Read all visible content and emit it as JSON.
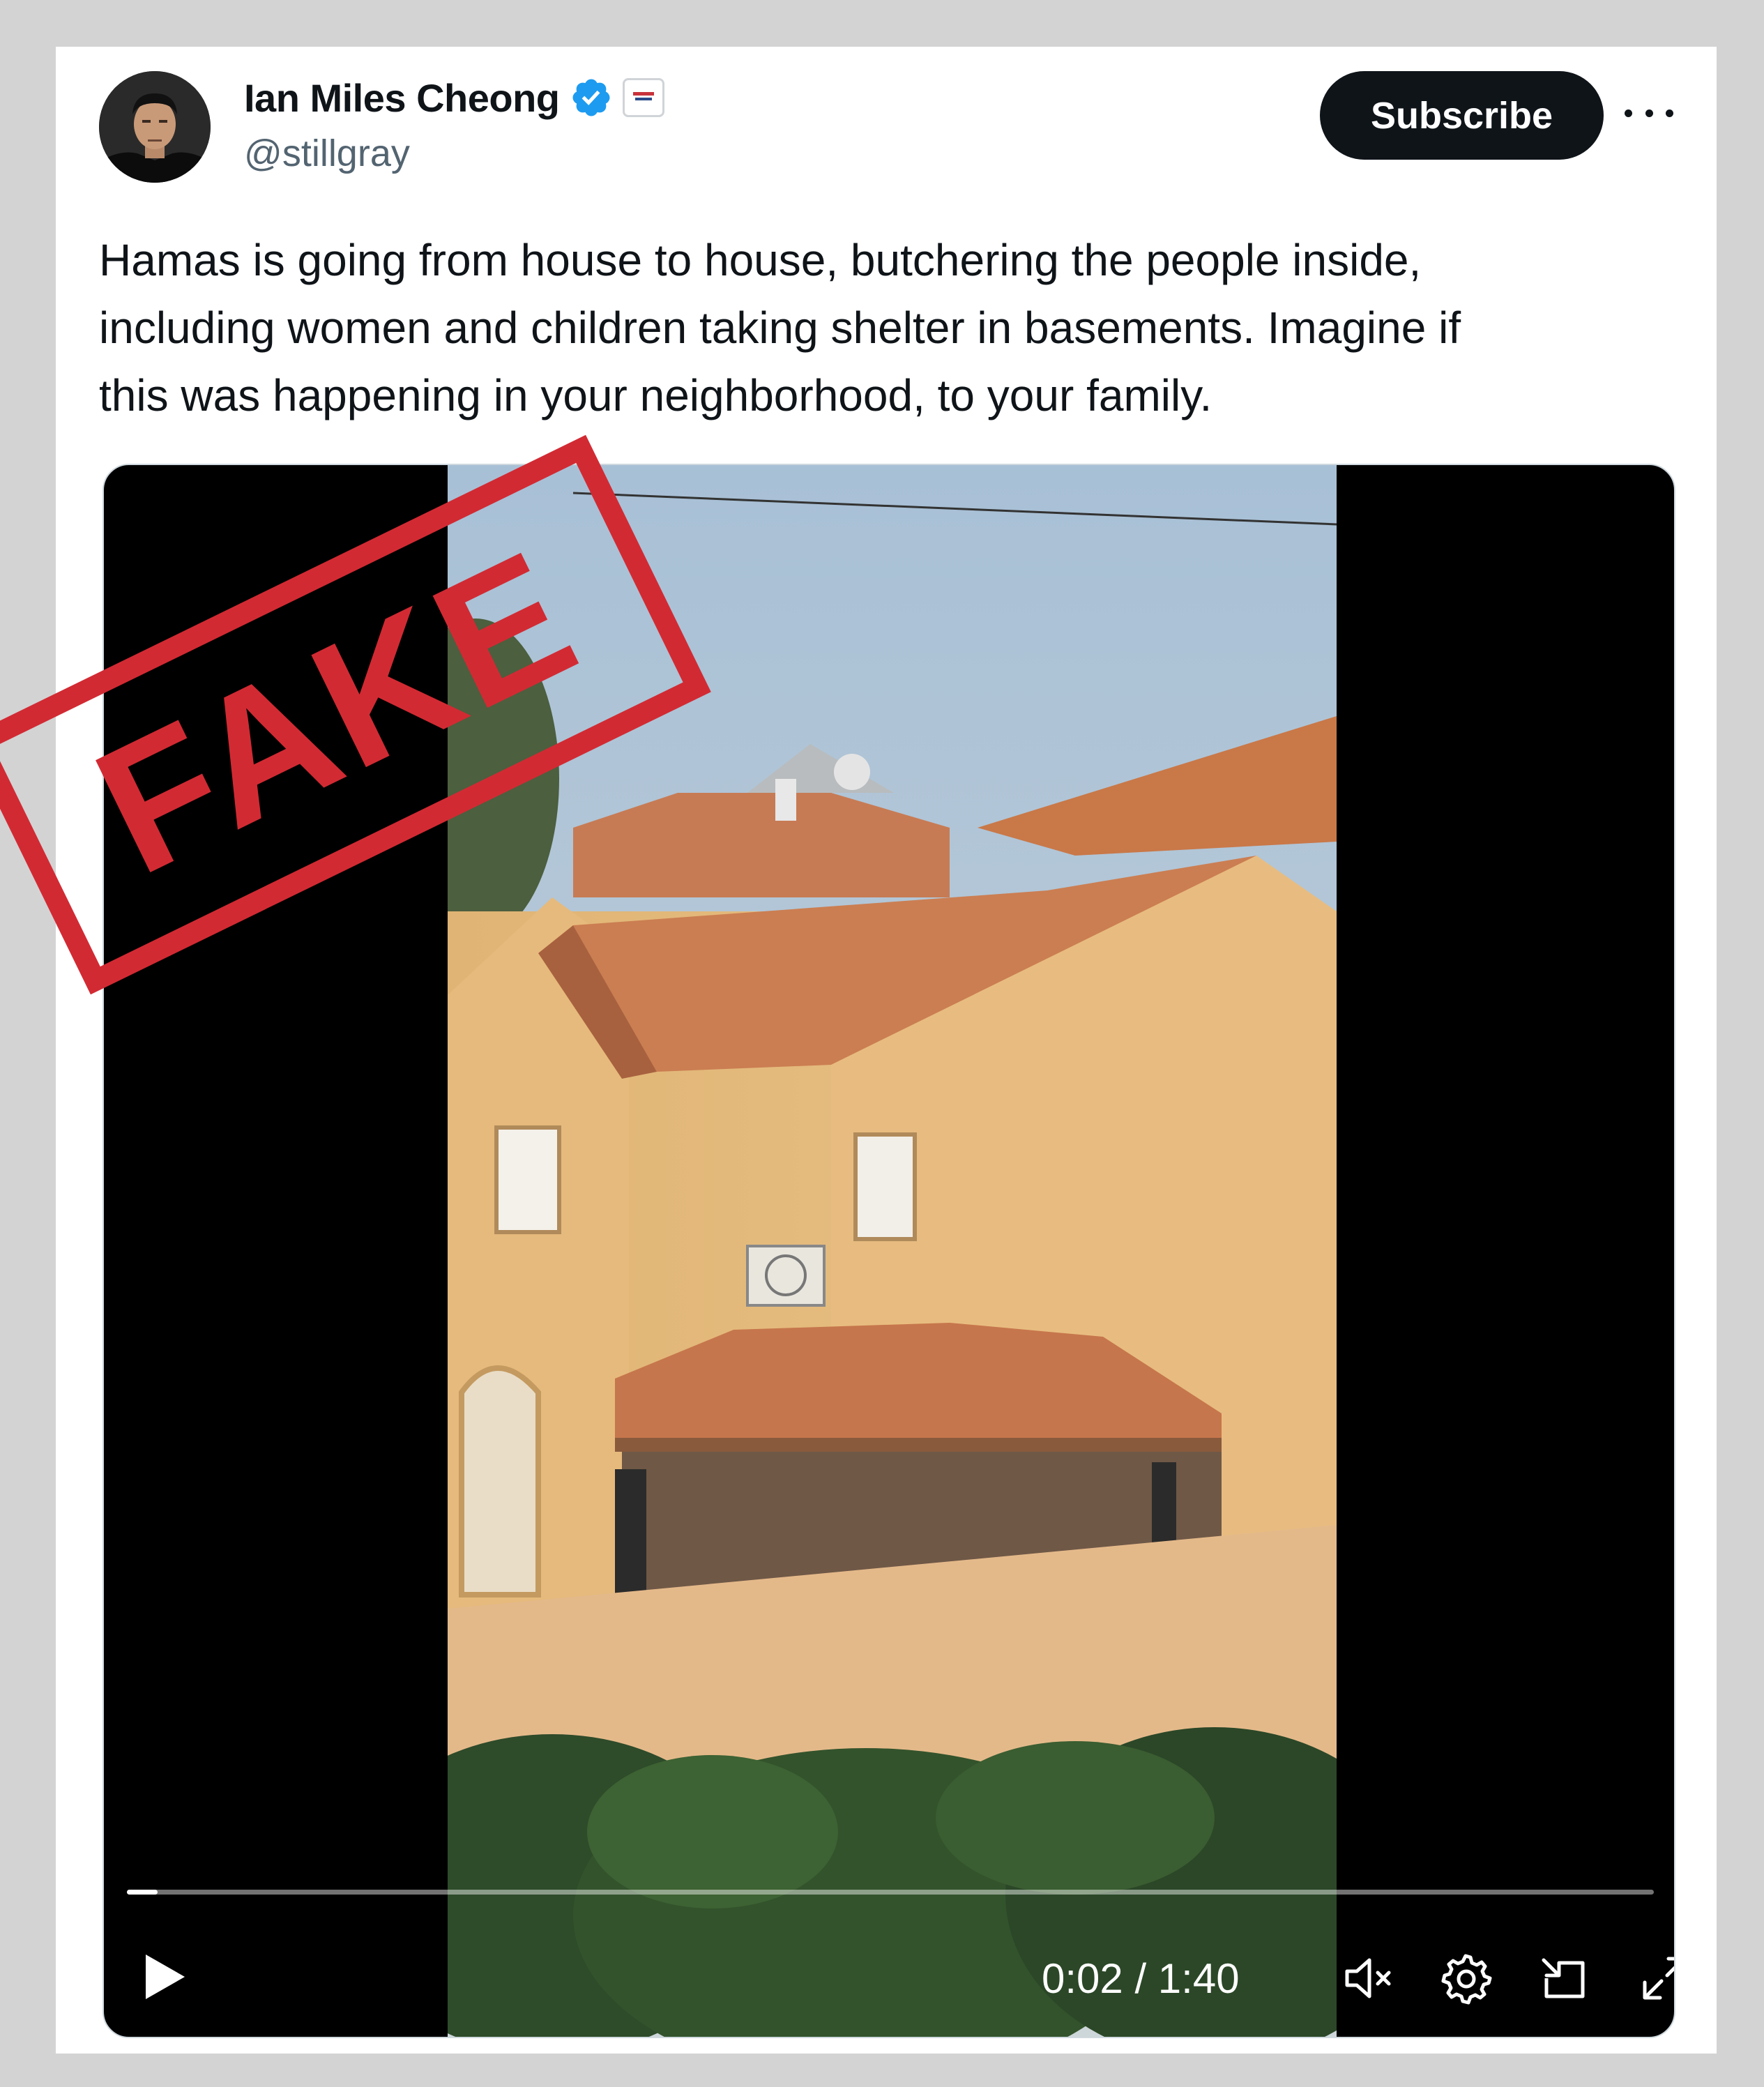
{
  "tweet": {
    "author_name": "Ian Miles Cheong",
    "handle": "@stillgray",
    "subscribe_label": "Subscribe",
    "text_lines": [
      "Hamas is going from house to house, butchering the people inside,",
      "including women and children taking shelter in basements. Imagine if",
      "this was happening in your neighborhood, to your family."
    ]
  },
  "video": {
    "current_time": "0:02",
    "duration": "1:40",
    "time_display": "0:02 / 1:40",
    "progress_fraction": 0.02
  },
  "overlay": {
    "stamp_text": "FAKE",
    "stamp_color": "#d22a33"
  },
  "colors": {
    "verified": "#1d9bf0",
    "text": "#0f1419",
    "secondary": "#536471"
  }
}
